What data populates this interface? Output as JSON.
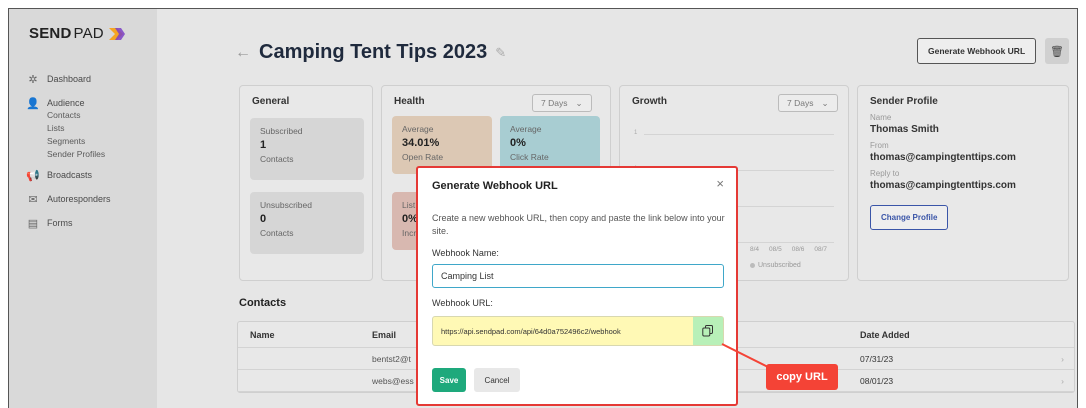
{
  "sidebar": {
    "logo_bold": "SEND",
    "logo_light": "PAD",
    "items": [
      {
        "label": "Dashboard",
        "icon": "dashboard-icon"
      },
      {
        "label": "Audience",
        "icon": "audience-icon",
        "sub": [
          "Contacts",
          "Lists",
          "Segments",
          "Sender Profiles"
        ]
      },
      {
        "label": "Broadcasts",
        "icon": "broadcast-icon"
      },
      {
        "label": "Autoresponders",
        "icon": "autoresponder-icon"
      },
      {
        "label": "Forms",
        "icon": "forms-icon"
      }
    ]
  },
  "header": {
    "title": "Camping Tent Tips 2023",
    "generate_button": "Generate Webhook URL"
  },
  "general": {
    "title": "General",
    "subscribed_label": "Subscribed",
    "subscribed_value": "1",
    "subscribed_unit": "Contacts",
    "unsubscribed_label": "Unsubscribed",
    "unsubscribed_value": "0",
    "unsubscribed_unit": "Contacts"
  },
  "health": {
    "title": "Health",
    "range": "7 Days",
    "open_label": "Average",
    "open_value": "34.01%",
    "open_unit": "Open Rate",
    "click_label": "Average",
    "click_value": "0%",
    "click_unit": "Click Rate",
    "list_label": "List",
    "list_value": "0%",
    "list_unit": "Incr"
  },
  "growth": {
    "title": "Growth",
    "range": "7 Days",
    "ticks": [
      "8/4",
      "08/5",
      "08/6",
      "08/7"
    ],
    "legend": "Unsubscribed",
    "y_ticks": [
      "1",
      "1"
    ]
  },
  "sender": {
    "title": "Sender Profile",
    "name_label": "Name",
    "name_value": "Thomas Smith",
    "from_label": "From",
    "from_value": "thomas@campingtenttips.com",
    "reply_label": "Reply to",
    "reply_value": "thomas@campingtenttips.com",
    "change_button": "Change Profile"
  },
  "contacts": {
    "title": "Contacts",
    "columns": [
      "Name",
      "Email",
      "Date Added"
    ],
    "rows": [
      {
        "email": "bentst2@t",
        "date": "07/31/23"
      },
      {
        "email": "webs@ess",
        "date": "08/01/23"
      }
    ]
  },
  "modal": {
    "title": "Generate Webhook URL",
    "description": "Create a new webhook URL, then copy and paste the link below into your site.",
    "name_label": "Webhook Name:",
    "name_value": "Camping List",
    "url_label": "Webhook URL:",
    "url_value": "https://api.sendpad.com/api/64d0a752496c2/webhook",
    "save": "Save",
    "cancel": "Cancel"
  },
  "callout": {
    "text": "copy URL",
    "color": "#f44336"
  },
  "colors": {
    "accent": "#1ea97c",
    "highlight": "#fff9b5",
    "modal_border": "#e53935"
  }
}
